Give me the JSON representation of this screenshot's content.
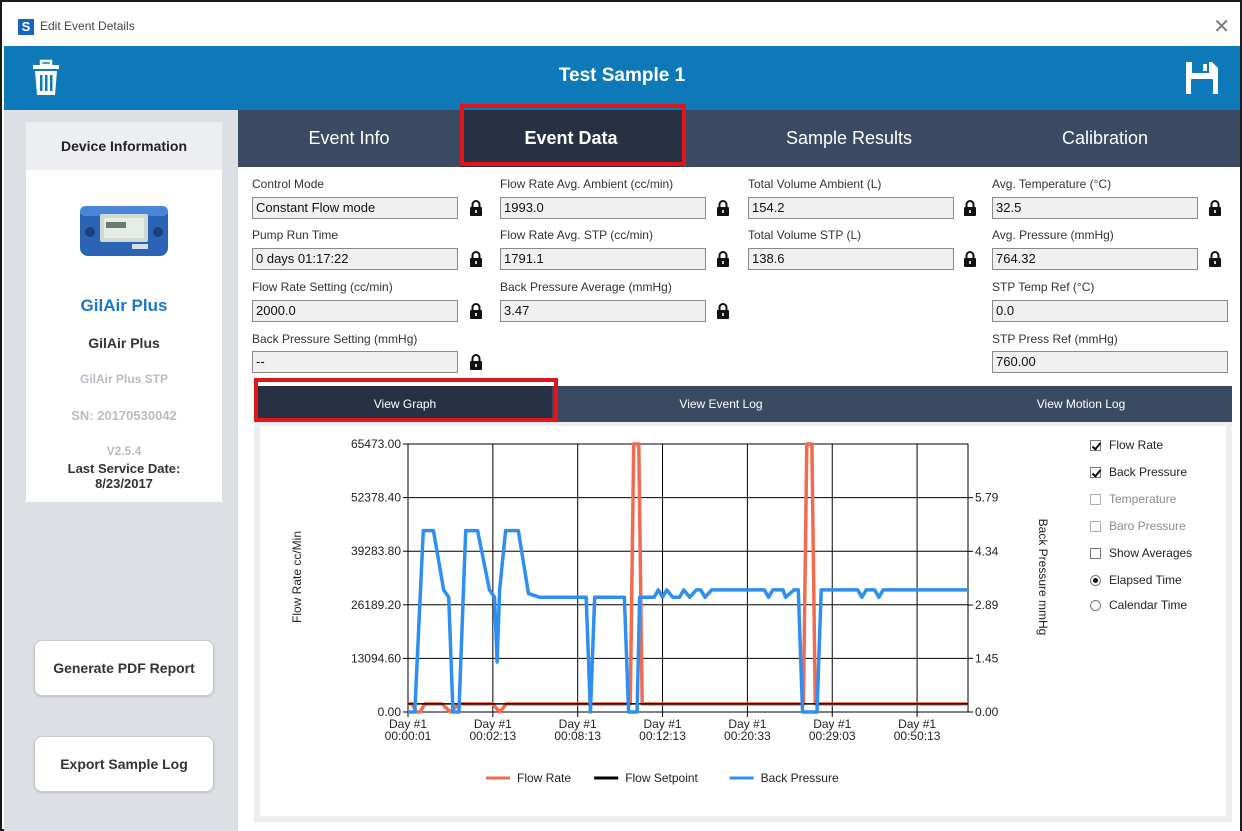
{
  "window": {
    "title": "Edit Event Details",
    "close_glyph": "✕",
    "logo_letter": "S"
  },
  "header": {
    "title": "Test Sample 1",
    "trash_icon": "trash-icon",
    "save_icon": "floppy-disk-icon",
    "color": "#0d79b8"
  },
  "sidebar": {
    "section_title": "Device Information",
    "device_name_primary": "GilAir Plus",
    "device_name": "GilAir Plus",
    "device_model": "GilAir Plus STP",
    "serial": "SN: 20170530042",
    "version": "V2.5.4",
    "last_service_label": "Last Service Date:",
    "last_service_date": "8/23/2017",
    "buttons": {
      "pdf": "Generate PDF Report",
      "export": "Export Sample Log"
    }
  },
  "tabs": [
    "Event Info",
    "Event Data",
    "Sample Results",
    "Calibration"
  ],
  "active_tab": "Event Data",
  "fields": {
    "control_mode": {
      "label": "Control Mode",
      "value": "Constant Flow mode"
    },
    "pump_run_time": {
      "label": "Pump Run Time",
      "value": "0 days 01:17:22"
    },
    "flow_rate_setting": {
      "label": "Flow Rate Setting (cc/min)",
      "value": "2000.0"
    },
    "back_pressure_setting": {
      "label": "Back Pressure Setting (mmHg)",
      "value": "--"
    },
    "flow_avg_ambient": {
      "label": "Flow Rate Avg. Ambient (cc/min)",
      "value": "1993.0"
    },
    "flow_avg_stp": {
      "label": "Flow Rate Avg. STP (cc/min)",
      "value": "1791.1"
    },
    "back_pressure_avg": {
      "label": "Back Pressure Average (mmHg)",
      "value": "3.47"
    },
    "total_vol_ambient": {
      "label": "Total Volume Ambient (L)",
      "value": "154.2"
    },
    "total_vol_stp": {
      "label": "Total Volume STP (L)",
      "value": "138.6"
    },
    "avg_temp": {
      "label": "Avg. Temperature (°C)",
      "value": "32.5"
    },
    "avg_pressure": {
      "label": "Avg. Pressure (mmHg)",
      "value": "764.32"
    },
    "stp_temp_ref": {
      "label": "STP Temp Ref (°C)",
      "value": "0.0"
    },
    "stp_press_ref": {
      "label": "STP Press Ref (mmHg)",
      "value": "760.00"
    }
  },
  "subtabs": [
    "View Graph",
    "View Event Log",
    "View Motion Log"
  ],
  "active_subtab": "View Graph",
  "graph_options": {
    "checkboxes": [
      {
        "label": "Flow Rate",
        "checked": true,
        "enabled": true
      },
      {
        "label": "Back Pressure",
        "checked": true,
        "enabled": true
      },
      {
        "label": "Temperature",
        "checked": false,
        "enabled": false
      },
      {
        "label": "Baro Pressure",
        "checked": false,
        "enabled": false
      },
      {
        "label": "Show Averages",
        "checked": false,
        "enabled": true
      }
    ],
    "radios": [
      {
        "label": "Elapsed Time",
        "checked": true
      },
      {
        "label": "Calendar Time",
        "checked": false
      }
    ]
  },
  "chart_data": {
    "type": "line",
    "ylabel": "Flow Rate cc/Min",
    "ylabel_right": "Back Pressure mmHg",
    "yticks_left": [
      "65473.00",
      "52378.40",
      "39283.80",
      "26189.20",
      "13094.60",
      "0.00"
    ],
    "yticks_right": [
      "5.79",
      "4.34",
      "2.89",
      "1.45",
      "0.00"
    ],
    "ylim": [
      0,
      65473
    ],
    "ylim_right": [
      0,
      7.24
    ],
    "xticks": [
      {
        "line1": "Day #1",
        "line2": "00:00:01"
      },
      {
        "line1": "Day #1",
        "line2": "00:02:13"
      },
      {
        "line1": "Day #1",
        "line2": "00:08:13"
      },
      {
        "line1": "Day #1",
        "line2": "00:12:13"
      },
      {
        "line1": "Day #1",
        "line2": "00:20:33"
      },
      {
        "line1": "Day #1",
        "line2": "00:29:03"
      },
      {
        "line1": "Day #1",
        "line2": "00:50:13"
      }
    ],
    "legend": [
      "Flow Rate",
      "Flow Setpoint",
      "Back Pressure"
    ],
    "series": [
      {
        "name": "Flow Rate",
        "color": "#f26b4f",
        "points": [
          [
            0,
            1993
          ],
          [
            0.05,
            1993
          ],
          [
            0.1,
            0
          ],
          [
            0.14,
            0
          ],
          [
            0.2,
            1993
          ],
          [
            0.4,
            1993
          ],
          [
            0.5,
            0
          ],
          [
            0.6,
            1993
          ],
          [
            1.0,
            1993
          ],
          [
            1.08,
            0
          ],
          [
            1.16,
            1993
          ],
          [
            2.62,
            1993
          ],
          [
            2.66,
            65473
          ],
          [
            2.72,
            65473
          ],
          [
            2.76,
            1993
          ],
          [
            4.66,
            1993
          ],
          [
            4.7,
            65473
          ],
          [
            4.76,
            65473
          ],
          [
            4.8,
            1993
          ],
          [
            6.6,
            1993
          ]
        ]
      },
      {
        "name": "Flow Setpoint",
        "color": "#000000",
        "points": [
          [
            0,
            2000
          ],
          [
            6.6,
            2000
          ]
        ]
      },
      {
        "name": "Back Pressure",
        "color": "#2e8ff0",
        "points": [
          [
            0,
            0
          ],
          [
            0.08,
            0
          ],
          [
            0.18,
            4.9
          ],
          [
            0.3,
            4.9
          ],
          [
            0.42,
            3.3
          ],
          [
            0.48,
            3.1
          ],
          [
            0.53,
            0
          ],
          [
            0.6,
            0
          ],
          [
            0.68,
            4.9
          ],
          [
            0.82,
            4.9
          ],
          [
            0.96,
            3.3
          ],
          [
            1.02,
            3.1
          ],
          [
            1.05,
            1.35
          ],
          [
            1.08,
            3.3
          ],
          [
            1.15,
            4.9
          ],
          [
            1.3,
            4.9
          ],
          [
            1.42,
            3.2
          ],
          [
            1.55,
            3.1
          ],
          [
            2.0,
            3.1
          ],
          [
            2.1,
            3.1
          ],
          [
            2.15,
            0
          ],
          [
            2.2,
            3.1
          ],
          [
            2.55,
            3.1
          ],
          [
            2.6,
            0
          ],
          [
            2.7,
            0
          ],
          [
            2.73,
            3.1
          ],
          [
            2.9,
            3.1
          ],
          [
            2.95,
            3.3
          ],
          [
            3.0,
            3.1
          ],
          [
            3.05,
            3.3
          ],
          [
            3.12,
            3.1
          ],
          [
            3.2,
            3.1
          ],
          [
            3.25,
            3.3
          ],
          [
            3.32,
            3.1
          ],
          [
            3.4,
            3.3
          ],
          [
            3.45,
            3.3
          ],
          [
            3.5,
            3.1
          ],
          [
            3.58,
            3.3
          ],
          [
            4.2,
            3.3
          ],
          [
            4.25,
            3.1
          ],
          [
            4.3,
            3.3
          ],
          [
            4.42,
            3.3
          ],
          [
            4.45,
            3.1
          ],
          [
            4.55,
            3.3
          ],
          [
            4.6,
            3.3
          ],
          [
            4.65,
            0
          ],
          [
            4.82,
            0
          ],
          [
            4.87,
            3.3
          ],
          [
            5.3,
            3.3
          ],
          [
            5.35,
            3.1
          ],
          [
            5.4,
            3.3
          ],
          [
            5.5,
            3.3
          ],
          [
            5.55,
            3.1
          ],
          [
            5.6,
            3.3
          ],
          [
            6.6,
            3.3
          ]
        ]
      }
    ]
  }
}
